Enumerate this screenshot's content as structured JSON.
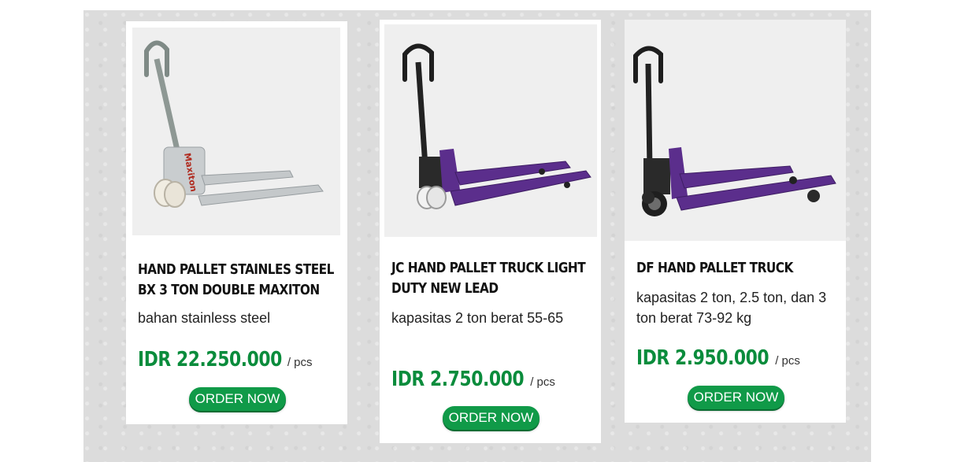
{
  "colors": {
    "price_green": "#0a8c3c",
    "button_green": "#109a48",
    "steel_frame": "#b8bcbf",
    "purple_frame": "#5b2e8c"
  },
  "products": [
    {
      "title": "HAND PALLET STAINLES STEEL BX 3 TON DOUBLE MAXITON",
      "description": "bahan stainless steel",
      "price": "IDR 22.250.000",
      "unit": "/ pcs",
      "button_label": "ORDER NOW",
      "image_icon": "stainless-hand-pallet-image",
      "brand_text": "Maxiton"
    },
    {
      "title": "JC HAND PALLET TRUCK LIGHT DUTY NEW LEAD",
      "description": "kapasitas 2 ton berat 55-65",
      "price": "IDR 2.750.000",
      "unit": "/ pcs",
      "button_label": "ORDER NOW",
      "image_icon": "purple-hand-pallet-image"
    },
    {
      "title": "DF HAND PALLET TRUCK",
      "description": "kapasitas 2 ton, 2.5 ton, dan 3 ton berat 73-92 kg",
      "price": "IDR 2.950.000",
      "unit": "/ pcs",
      "button_label": "ORDER NOW",
      "image_icon": "purple-hand-pallet-image"
    }
  ]
}
